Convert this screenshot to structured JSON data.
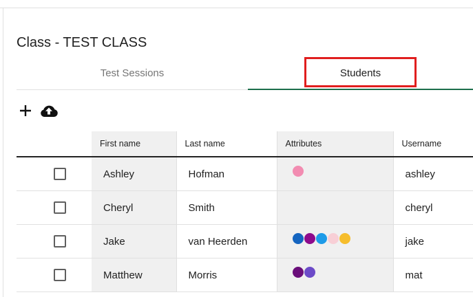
{
  "page": {
    "title": "Class - TEST CLASS"
  },
  "tabs": [
    {
      "label": "Test Sessions",
      "active": false
    },
    {
      "label": "Students",
      "active": true
    }
  ],
  "toolbar": {
    "add_icon": "plus-icon",
    "upload_icon": "cloud-upload-icon"
  },
  "table": {
    "columns": [
      "First name",
      "Last name",
      "Attributes",
      "Username"
    ],
    "rows": [
      {
        "first_name": "Ashley",
        "last_name": "Hofman",
        "attributes": [
          "#f28cb1"
        ],
        "username": "ashley"
      },
      {
        "first_name": "Cheryl",
        "last_name": "Smith",
        "attributes": [],
        "username": "cheryl"
      },
      {
        "first_name": "Jake",
        "last_name": "van Heerden",
        "attributes": [
          "#1565c0",
          "#8e0b8c",
          "#1e9be8",
          "#f8cfd6",
          "#f6bd2c"
        ],
        "username": "jake"
      },
      {
        "first_name": "Matthew",
        "last_name": "Morris",
        "attributes": [
          "#6a0e7a",
          "#6c4bc8"
        ],
        "username": "mat"
      }
    ]
  },
  "colors": {
    "tab_indicator": "#1b6e4a",
    "highlight": "#e01e1e"
  }
}
